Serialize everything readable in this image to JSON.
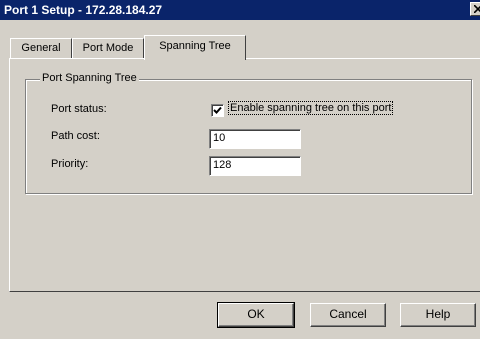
{
  "window": {
    "title": "Port 1 Setup - 172.28.184.27"
  },
  "tabs": [
    {
      "label": "General"
    },
    {
      "label": "Port Mode"
    },
    {
      "label": "Spanning Tree"
    }
  ],
  "group": {
    "legend": "Port Spanning Tree",
    "port_status_label": "Port status:",
    "enable_checkbox_label": "Enable spanning tree on this port",
    "enable_checked": true,
    "path_cost_label": "Path cost:",
    "path_cost_value": "10",
    "priority_label": "Priority:",
    "priority_value": "128"
  },
  "buttons": {
    "ok": "OK",
    "cancel": "Cancel",
    "help": "Help"
  },
  "icons": {
    "close": "close-icon",
    "check": "checkmark-icon"
  },
  "colors": {
    "titlebar": "#0a246a",
    "face": "#d4d0c8"
  }
}
